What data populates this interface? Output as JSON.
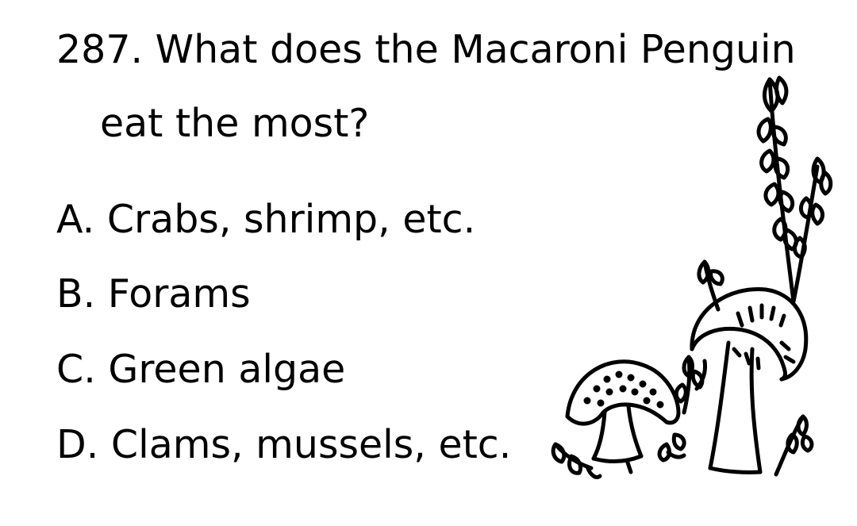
{
  "question": {
    "line1": "287. What does the Macaroni Penguin",
    "line2": "eat the most?"
  },
  "options": [
    {
      "letter": "A.",
      "text": "Crabs, shrimp, etc."
    },
    {
      "letter": "B.",
      "text": "Forams"
    },
    {
      "letter": "C.",
      "text": "Green algae"
    },
    {
      "letter": "D.",
      "text": "Clams, mussels, etc."
    }
  ],
  "illustration": {
    "icon": "mushrooms-and-plants-line-drawing",
    "stroke_color": "#000000"
  }
}
